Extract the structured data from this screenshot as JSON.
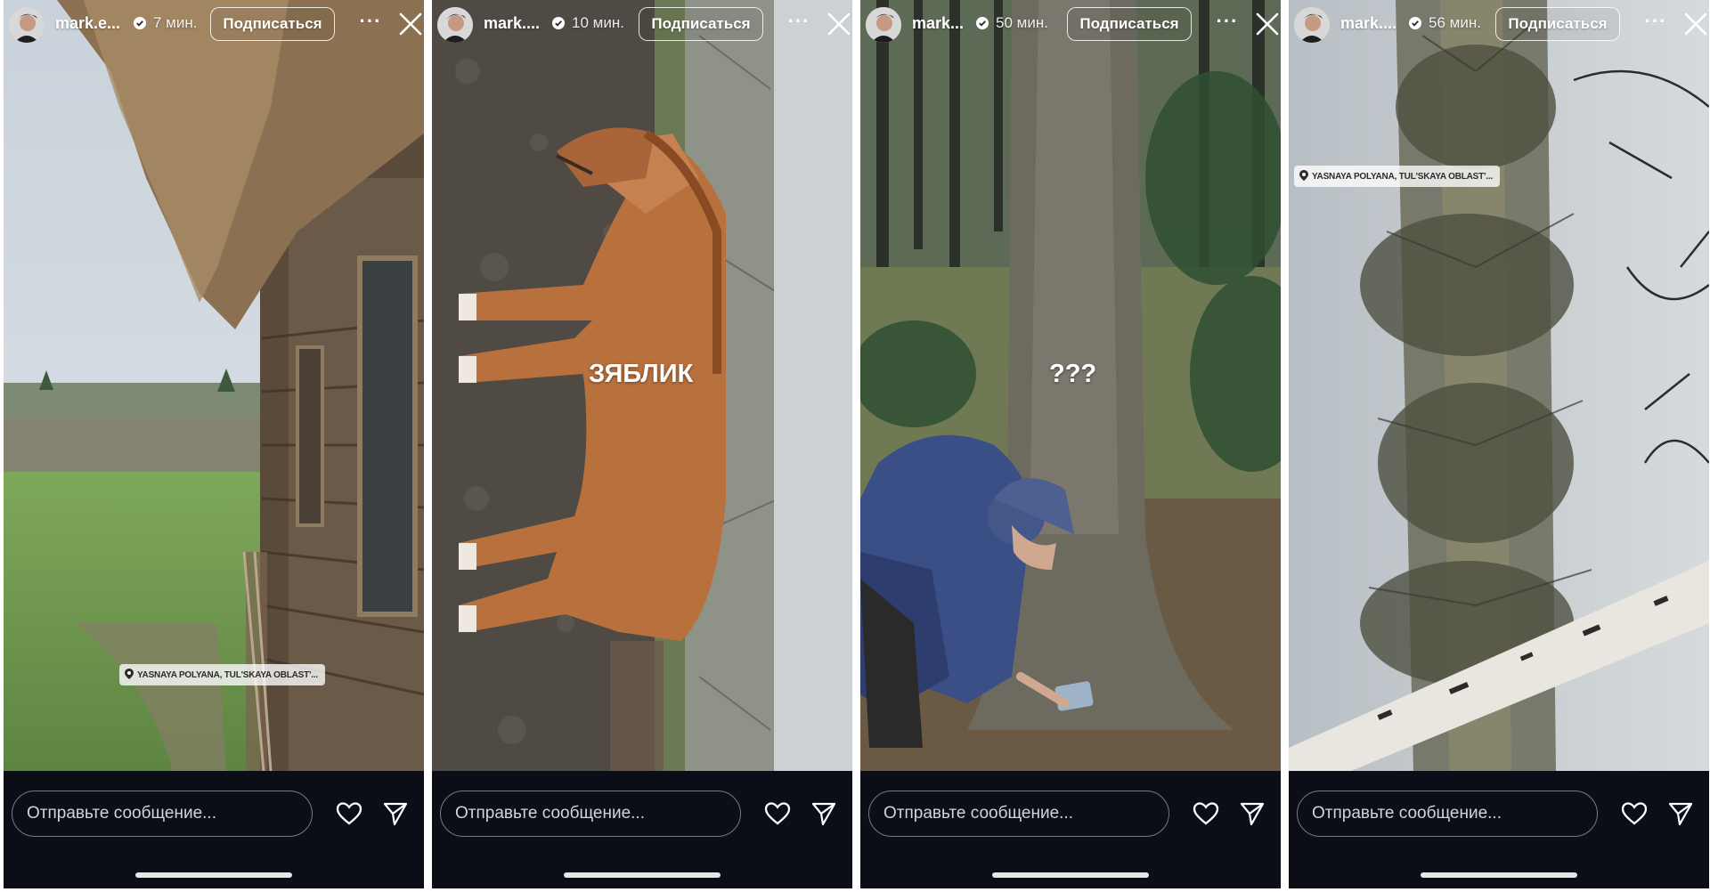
{
  "stories": [
    {
      "username": "mark.e...",
      "time": "7 мин.",
      "subscribe_label": "Подписаться",
      "more_label": "···",
      "location": "YASNAYA POLYANA, TUL'SKAYA OBLAST'...",
      "caption": "",
      "message_placeholder": "Отправьте сообщение..."
    },
    {
      "username": "mark....",
      "time": "10 мин.",
      "subscribe_label": "Подписаться",
      "more_label": "···",
      "location": "",
      "caption": "ЗЯБЛИК",
      "message_placeholder": "Отправьте сообщение..."
    },
    {
      "username": "mark...",
      "time": "50 мин.",
      "subscribe_label": "Подписаться",
      "more_label": "···",
      "location": "",
      "caption": "???",
      "message_placeholder": "Отправьте сообщение..."
    },
    {
      "username": "mark....",
      "time": "56 мин.",
      "subscribe_label": "Подписаться",
      "more_label": "···",
      "location": "YASNAYA POLYANA, TUL'SKAYA OBLAST'...",
      "caption": "",
      "message_placeholder": "Отправьте сообщение..."
    }
  ],
  "icons": {
    "verified": "verified-badge-icon",
    "close": "close-icon",
    "heart": "heart-icon",
    "send": "send-icon",
    "pin": "location-pin-icon"
  },
  "colors": {
    "bottom_bar": "#0b0e17",
    "text": "#ffffff"
  }
}
